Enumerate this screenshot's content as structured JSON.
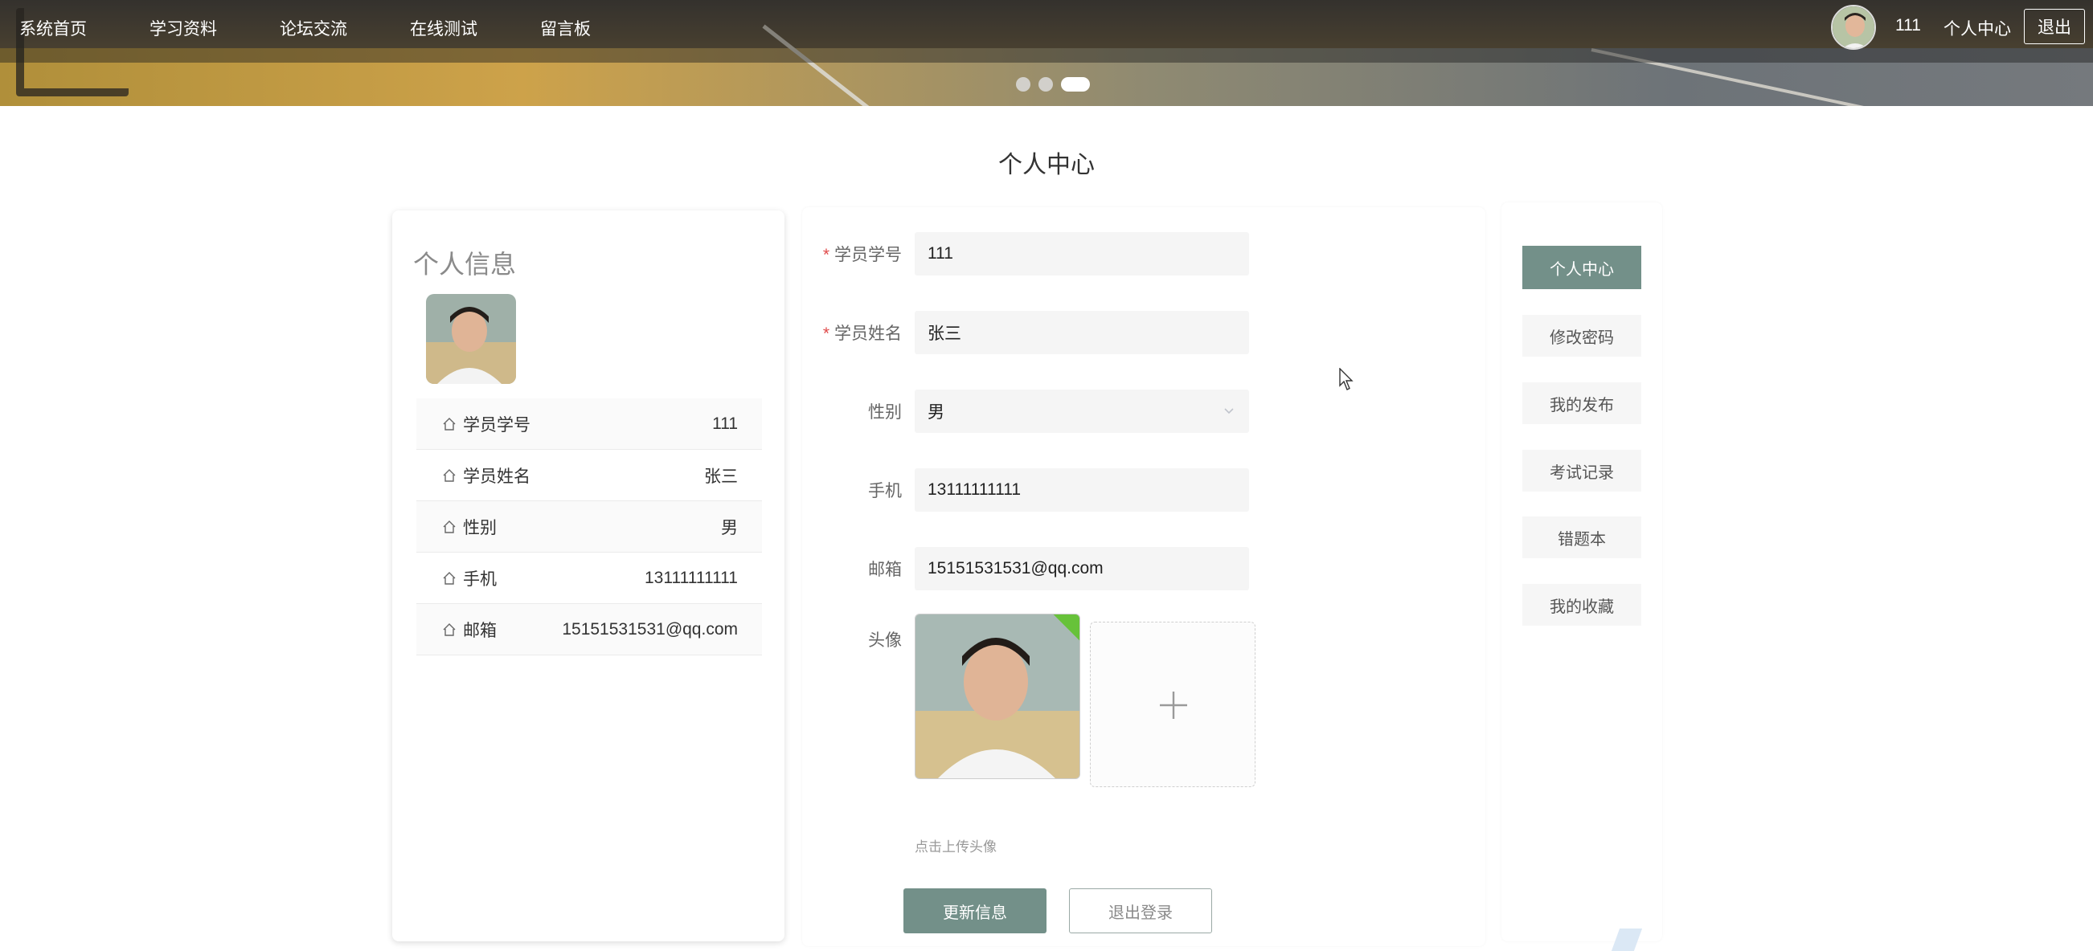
{
  "nav": {
    "items": [
      "系统首页",
      "学习资料",
      "论坛交流",
      "在线测试",
      "留言板"
    ]
  },
  "topbar": {
    "username": "111",
    "center_link": "个人中心",
    "logout": "退出"
  },
  "carousel": {
    "slides": 3,
    "active_index": 2
  },
  "page_title": "个人中心",
  "profile_card": {
    "title": "个人信息",
    "rows": [
      {
        "label": "学员学号",
        "value": "111"
      },
      {
        "label": "学员姓名",
        "value": "张三"
      },
      {
        "label": "性别",
        "value": "男"
      },
      {
        "label": "手机",
        "value": "13111111111"
      },
      {
        "label": "邮箱",
        "value": "15151531531@qq.com"
      }
    ]
  },
  "form": {
    "student_no_label": "学员学号",
    "student_no": "111",
    "name_label": "学员姓名",
    "name": "张三",
    "gender_label": "性别",
    "gender": "男",
    "phone_label": "手机",
    "phone": "13111111111",
    "email_label": "邮箱",
    "email": "15151531531@qq.com",
    "avatar_label": "头像",
    "upload_hint": "点击上传头像",
    "required_mark": "*",
    "update_button": "更新信息",
    "logout_button": "退出登录"
  },
  "side_menu": {
    "items": [
      "个人中心",
      "修改密码",
      "我的发布",
      "考试记录",
      "错题本",
      "我的收藏"
    ],
    "active_index": 0
  },
  "colors": {
    "accent": "#739089",
    "required": "#e04b4b",
    "upload_ok": "#67c23a"
  }
}
